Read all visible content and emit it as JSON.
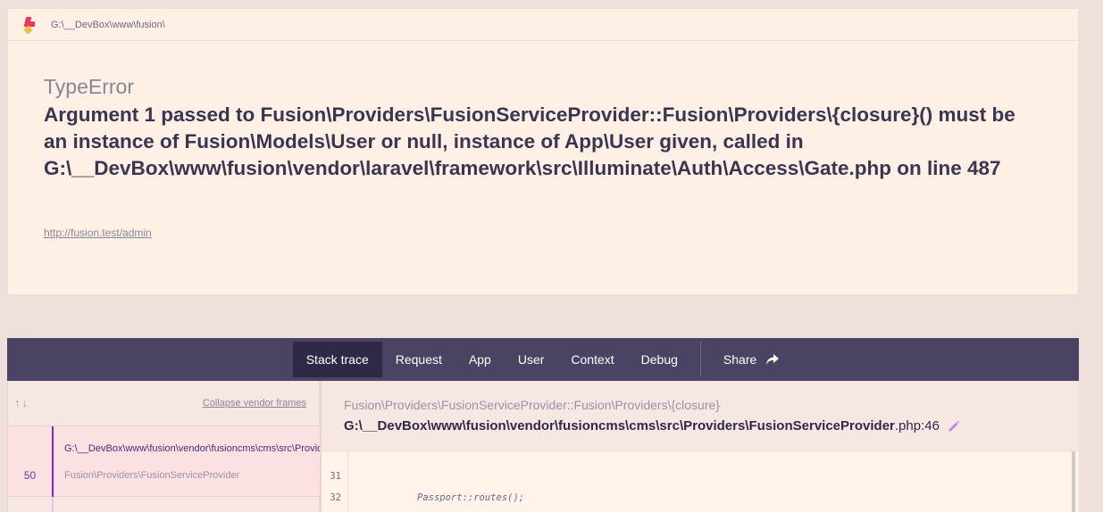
{
  "header": {
    "path": "G:\\__DevBox\\www\\fusion\\"
  },
  "error": {
    "type": "TypeError",
    "message": "Argument 1 passed to Fusion\\Providers\\FusionServiceProvider::Fusion\\Providers\\{closure}() must be an instance of Fusion\\Models\\User or null, instance of App\\User given, called in G:\\__DevBox\\www\\fusion\\vendor\\laravel\\framework\\src\\Illuminate\\Auth\\Access\\Gate.php on line 487",
    "url": "http://fusion.test/admin"
  },
  "tabs": [
    {
      "label": "Stack trace",
      "active": true
    },
    {
      "label": "Request"
    },
    {
      "label": "App"
    },
    {
      "label": "User"
    },
    {
      "label": "Context"
    },
    {
      "label": "Debug"
    }
  ],
  "share_label": "Share",
  "stack": {
    "nav_arrows": "↑↓",
    "collapse_label": "Collapse vendor frames",
    "frames": [
      {
        "number": "50",
        "file": "G:\\__DevBox\\www\\fusion\\vendor\\fusioncms\\cms\\src\\Providers\\FusionServiceProvider.php",
        "class": "Fusion\\Providers\\FusionServiceProvider"
      }
    ]
  },
  "detail": {
    "method": "Fusion\\Providers\\FusionServiceProvider::Fusion\\Providers\\{closure}",
    "file_main": "G:\\__DevBox\\www\\fusion\\vendor\\fusioncms\\cms\\src\\Providers\\FusionServiceProvider",
    "file_ext": ".php:46",
    "code_lines": [
      {
        "number": "31",
        "text": ""
      },
      {
        "number": "32",
        "text": "Passport::routes();"
      }
    ]
  },
  "colors": {
    "accent": "#7d2bd1",
    "tabbar": "#4a4363",
    "logo_red": "#e8365d",
    "logo_yellow": "#f5b82e"
  }
}
